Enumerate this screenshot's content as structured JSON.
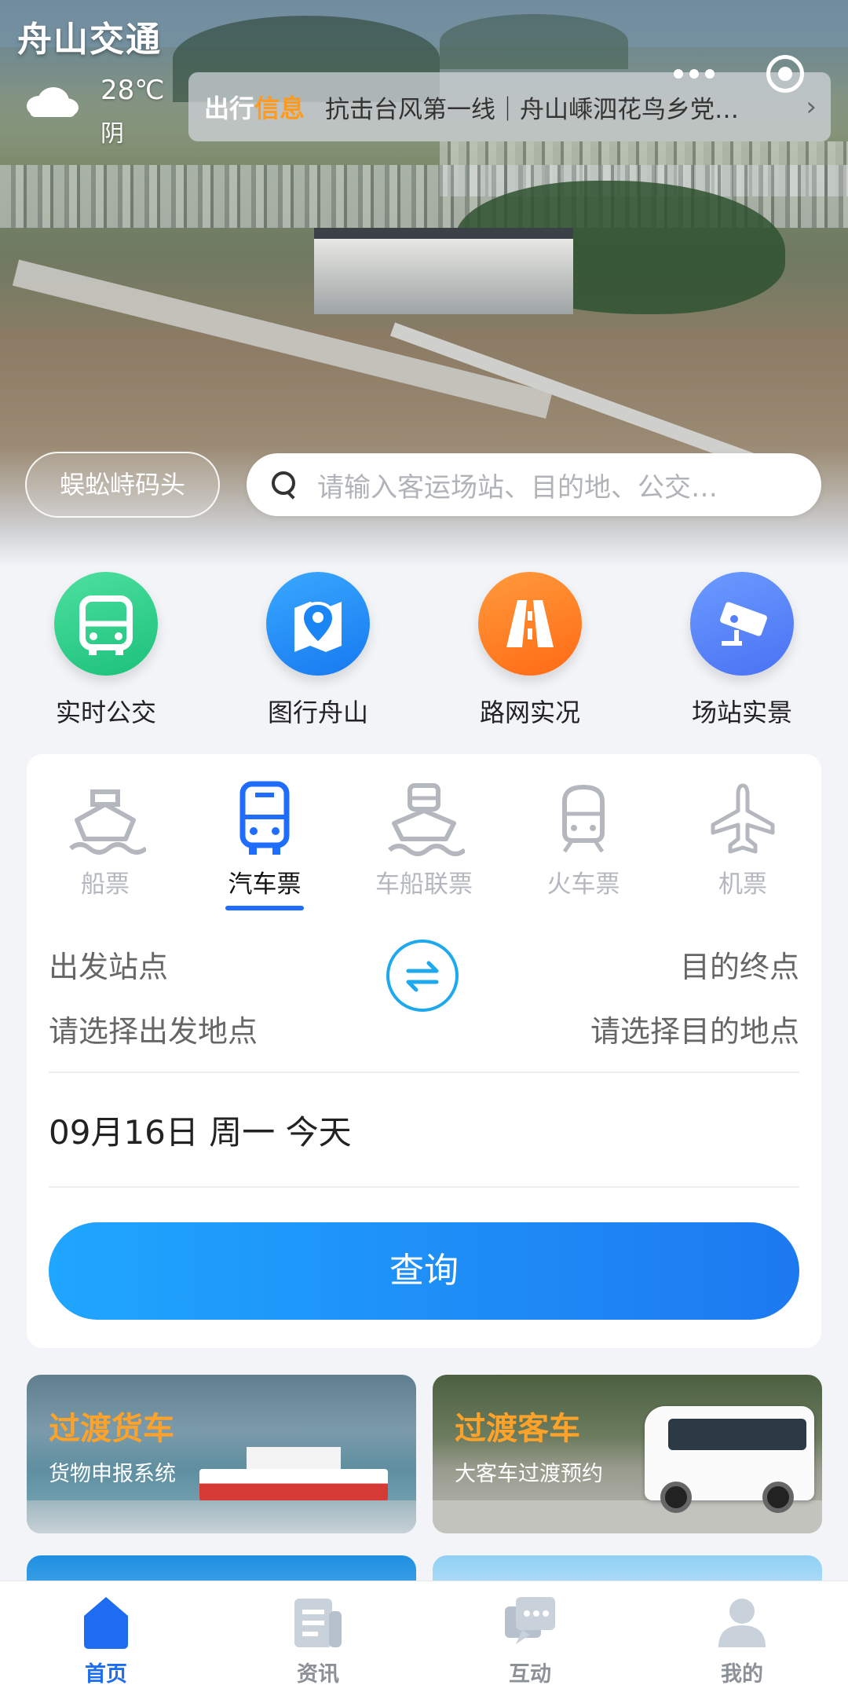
{
  "app": {
    "logo_text": "舟山交通"
  },
  "weather": {
    "temperature": "28℃",
    "condition": "阴",
    "icon": "cloud-icon"
  },
  "news": {
    "tag_prefix": "出行",
    "tag_highlight": "信息",
    "headline": "抗击台风第一线｜舟山嵊泗花鸟乡党…",
    "chevron": "›"
  },
  "location": {
    "station_label": "蜈蚣峙码头"
  },
  "search": {
    "placeholder": "请输入客运场站、目的地、公交…"
  },
  "quick_links": [
    {
      "label": "实时公交",
      "icon": "bus-icon",
      "color": "#1fc57f"
    },
    {
      "label": "图行舟山",
      "icon": "map-pin-icon",
      "color": "#1a86f5"
    },
    {
      "label": "路网实况",
      "icon": "road-icon",
      "color": "#ff7b22"
    },
    {
      "label": "场站实景",
      "icon": "camera-icon",
      "color": "#5580f7"
    }
  ],
  "ticket_tabs": [
    {
      "label": "船票",
      "icon": "ship-icon",
      "active": false
    },
    {
      "label": "汽车票",
      "icon": "bus-icon",
      "active": true
    },
    {
      "label": "车船联票",
      "icon": "car-ferry-icon",
      "active": false
    },
    {
      "label": "火车票",
      "icon": "train-icon",
      "active": false
    },
    {
      "label": "机票",
      "icon": "plane-icon",
      "active": false
    }
  ],
  "route": {
    "from_label": "出发站点",
    "from_placeholder": "请选择出发地点",
    "to_label": "目的终点",
    "to_placeholder": "请选择目的地点"
  },
  "date_text": "09月16日 周一 今天",
  "query_label": "查询",
  "promos": [
    {
      "title": "过渡货车",
      "subtitle": "货物申报系统"
    },
    {
      "title": "过渡客车",
      "subtitle": "大客车过渡预约"
    }
  ],
  "nav": [
    {
      "label": "首页",
      "icon": "home-icon",
      "active": true
    },
    {
      "label": "资讯",
      "icon": "news-icon",
      "active": false
    },
    {
      "label": "互动",
      "icon": "chat-icon",
      "active": false
    },
    {
      "label": "我的",
      "icon": "user-icon",
      "active": false
    }
  ],
  "colors": {
    "accent": "#1d6cf2",
    "news_highlight": "#ff9a1f",
    "promo_title": "#ffa22a"
  }
}
